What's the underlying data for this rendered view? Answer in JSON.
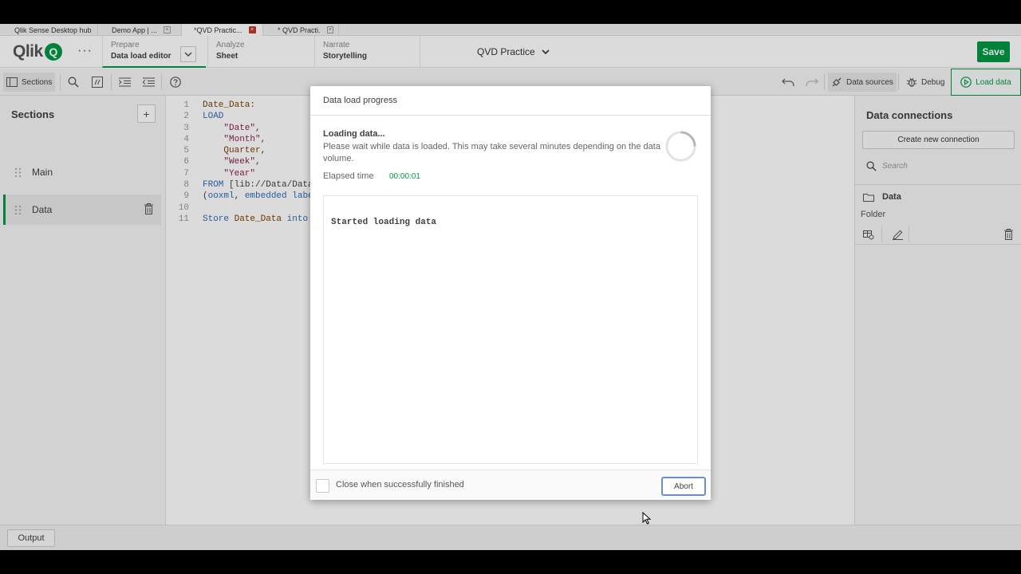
{
  "browser_tabs": [
    {
      "label": "Qlik Sense Desktop hub"
    },
    {
      "label": "Demo App | ..."
    },
    {
      "label": "*QVD Practic..."
    },
    {
      "label": "* QVD Practi..."
    }
  ],
  "header": {
    "logo_text": "Qlik",
    "logo_q": "Q",
    "more_label": "···",
    "nav": [
      {
        "key": "Prepare",
        "value": "Data load editor"
      },
      {
        "key": "Analyze",
        "value": "Sheet"
      },
      {
        "key": "Narrate",
        "value": "Storytelling"
      }
    ],
    "app_title": "QVD Practice",
    "save_label": "Save"
  },
  "toolbar": {
    "sections_label": "Sections",
    "data_sources_label": "Data sources",
    "debug_label": "Debug",
    "load_data_label": "Load data"
  },
  "sections_panel": {
    "title": "Sections",
    "add_label": "+",
    "items": [
      {
        "label": "Main"
      },
      {
        "label": "Data"
      }
    ]
  },
  "editor": {
    "line_numbers": [
      "1",
      "2",
      "3",
      "4",
      "5",
      "6",
      "7",
      "8",
      "9",
      "10",
      "11"
    ],
    "lines": [
      {
        "parts": [
          {
            "t": "Date_Data:",
            "c": "id"
          }
        ]
      },
      {
        "parts": [
          {
            "t": "LOAD",
            "c": "kw"
          }
        ]
      },
      {
        "parts": [
          {
            "t": "    ",
            "c": ""
          },
          {
            "t": "\"Date\"",
            "c": "str"
          },
          {
            "t": ",",
            "c": ""
          }
        ]
      },
      {
        "parts": [
          {
            "t": "    ",
            "c": ""
          },
          {
            "t": "\"Month\"",
            "c": "str"
          },
          {
            "t": ",",
            "c": ""
          }
        ]
      },
      {
        "parts": [
          {
            "t": "    ",
            "c": ""
          },
          {
            "t": "Quarter",
            "c": "id"
          },
          {
            "t": ",",
            "c": ""
          }
        ]
      },
      {
        "parts": [
          {
            "t": "    ",
            "c": ""
          },
          {
            "t": "\"Week\"",
            "c": "str"
          },
          {
            "t": ",",
            "c": ""
          }
        ]
      },
      {
        "parts": [
          {
            "t": "    ",
            "c": ""
          },
          {
            "t": "\"Year\"",
            "c": "str"
          }
        ]
      },
      {
        "parts": [
          {
            "t": "FROM ",
            "c": "kw"
          },
          {
            "t": "[lib://Data/Data",
            "c": ""
          }
        ]
      },
      {
        "parts": [
          {
            "t": "(",
            "c": ""
          },
          {
            "t": "ooxml",
            "c": "kw"
          },
          {
            "t": ", ",
            "c": ""
          },
          {
            "t": "embedded labe",
            "c": "kw"
          }
        ]
      },
      {
        "parts": [
          {
            "t": "",
            "c": ""
          }
        ]
      },
      {
        "parts": [
          {
            "t": "Store ",
            "c": "kw"
          },
          {
            "t": "Date_Data",
            "c": "id"
          },
          {
            "t": " ",
            "c": ""
          },
          {
            "t": "into",
            "c": "kw"
          }
        ]
      }
    ]
  },
  "connections_panel": {
    "title": "Data connections",
    "create_label": "Create new connection",
    "search_placeholder": "Search",
    "folder_name": "Data",
    "folder_type": "Folder"
  },
  "footer": {
    "output_label": "Output"
  },
  "dialog": {
    "title": "Data load progress",
    "loading_label": "Loading data...",
    "message": "Please wait while data is loaded. This may take several minutes depending on the data volume.",
    "elapsed_label": "Elapsed time",
    "elapsed_value": "00:00:01",
    "log_text": "Started loading data",
    "close_checkbox_label": "Close when successfully finished",
    "abort_label": "Abort"
  },
  "colors": {
    "accent": "#009845",
    "focus": "#6a8fc7"
  }
}
